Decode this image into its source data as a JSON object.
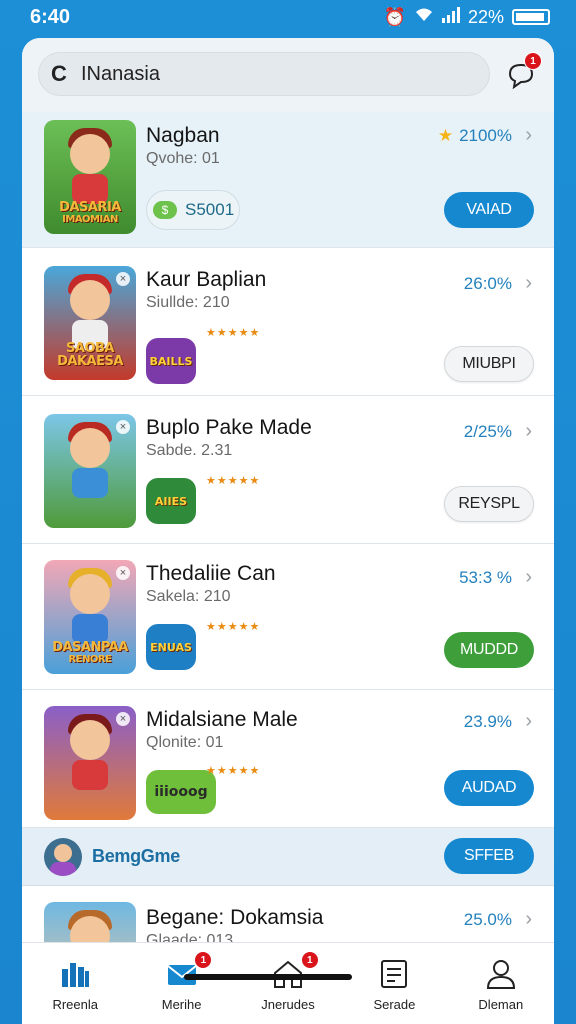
{
  "status_bar": {
    "time": "6:40",
    "battery": "22%"
  },
  "search": {
    "value": "INanasia",
    "notification_count": "1"
  },
  "items": [
    {
      "title": "Nagban",
      "subtitle": "Qvohe: 01",
      "percent": "2100%",
      "coin_value": "S5001",
      "button": "VAIAD",
      "button_style": "blue",
      "thumb_text": "DASARIA",
      "thumb_subtext": "IMAOMIAN",
      "thumb_bg": "#5aa84a"
    },
    {
      "title": "Kaur Baplian",
      "subtitle": "Siullde: 210",
      "percent": "26:0%",
      "stars": "★★★★★",
      "logo_text": "BAILLS",
      "button": "MIUBPI",
      "button_style": "white",
      "thumb_text": "SAOBA DAKAESA",
      "thumb_bg": "#c43a2a"
    },
    {
      "title": "Buplo Pake Made",
      "subtitle": "Sabde. 2.31",
      "percent": "2/25%",
      "stars": "★★★★★",
      "logo_text": "AIIES",
      "button": "REYSPL",
      "button_style": "white",
      "thumb_text": "",
      "thumb_bg": "#4f9b3a"
    },
    {
      "title": "Thedaliie Can",
      "subtitle": "Sakela: 210",
      "percent": "53:3 %",
      "stars": "★★★★★",
      "logo_text": "ENUAS",
      "button": "MUDDD",
      "button_style": "green",
      "thumb_text": "DASANPAA",
      "thumb_subtext": "RENORE",
      "thumb_bg": "#e89aa8"
    },
    {
      "title": "Midalsiane Male",
      "subtitle": "Qlonite: 01",
      "percent": "23.9%",
      "stars": "★★★★★",
      "logo_text": "iiiooog",
      "button": "AUDAD",
      "button_style": "blue",
      "thumb_text": "",
      "thumb_bg": "#e07a3a"
    }
  ],
  "promo": {
    "label": "BemgGme",
    "button": "SFFEB"
  },
  "last_item": {
    "title": "Begane: Dokamsia",
    "subtitle": "Glaade: 013",
    "percent": "25.0%"
  },
  "tabs": [
    {
      "label": "Rreenla",
      "icon": "bar-chart-icon",
      "badge": ""
    },
    {
      "label": "Merihe",
      "icon": "mail-icon",
      "badge": "1"
    },
    {
      "label": "Jnerudes",
      "icon": "home-icon",
      "badge": "1"
    },
    {
      "label": "Serade",
      "icon": "document-icon",
      "badge": ""
    },
    {
      "label": "Dleman",
      "icon": "user-icon",
      "badge": ""
    }
  ],
  "colors": {
    "accent": "#1588d0",
    "green": "#3d9e3a",
    "badge": "#d9141b",
    "background": "#1c8fd6"
  }
}
